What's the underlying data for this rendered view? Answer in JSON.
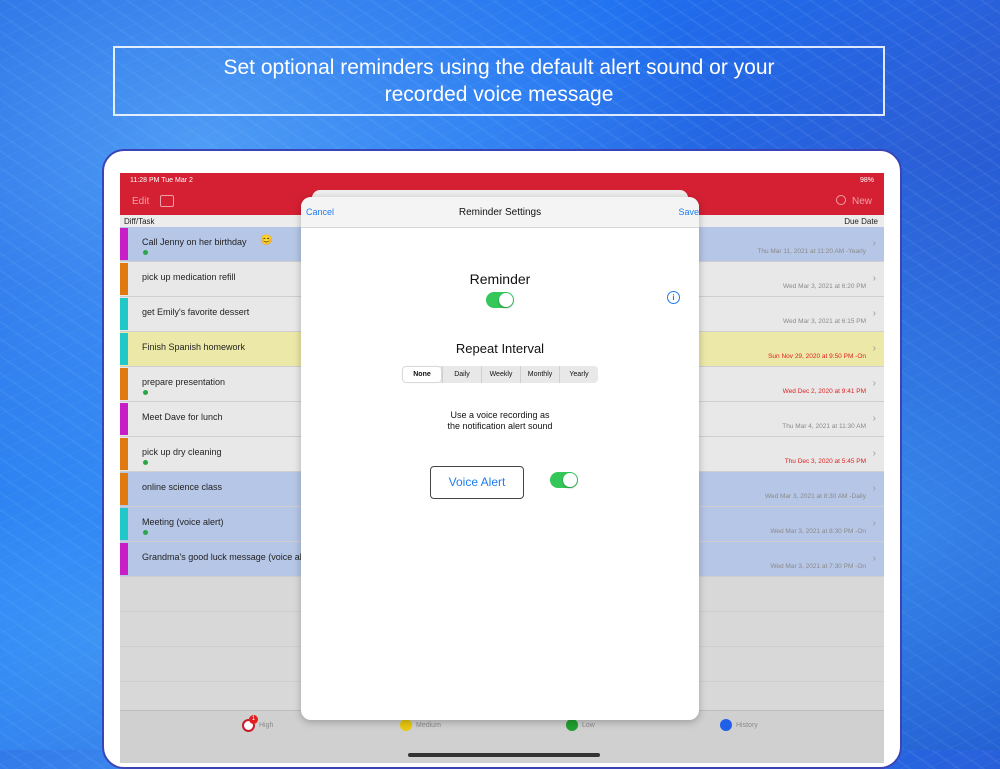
{
  "caption": "Set optional reminders using the default alert sound or your\nrecorded voice message",
  "status": {
    "time": "11:28 PM   Tue Mar 2",
    "battery": "98%"
  },
  "nav": {
    "edit": "Edit",
    "new": "New"
  },
  "columns": {
    "left": "Diff/Task",
    "right": "Due Date"
  },
  "tasks": [
    {
      "title": "Call Jenny on her birthday",
      "emoji": "😊",
      "color": "#c81ec8",
      "bg": "#b6c6e6",
      "dot": true,
      "due": "Thu Mar 11, 2021 at 11:20 AM -Yearly",
      "due_red": false
    },
    {
      "title": "pick up medication refill",
      "emoji": "",
      "color": "#e07a10",
      "bg": "#e8e8e8",
      "dot": false,
      "due": "Wed Mar 3, 2021 at 6:20 PM",
      "due_red": false
    },
    {
      "title": "get Emily's favorite dessert",
      "emoji": "",
      "color": "#20c8c8",
      "bg": "#e8e8e8",
      "dot": false,
      "due": "Wed Mar 3, 2021 at 6:15 PM",
      "due_red": false
    },
    {
      "title": "Finish Spanish homework",
      "emoji": "",
      "color": "#20c8c8",
      "bg": "#ece8a8",
      "dot": false,
      "due": "Sun Nov 29, 2020 at 9:50 PM -On",
      "due_red": true
    },
    {
      "title": "prepare presentation",
      "emoji": "",
      "color": "#e07a10",
      "bg": "#e8e8e8",
      "dot": true,
      "due": "Wed Dec 2, 2020 at 9:41 PM",
      "due_red": true
    },
    {
      "title": "Meet Dave for lunch",
      "emoji": "",
      "color": "#c81ec8",
      "bg": "#e8e8e8",
      "dot": false,
      "due": "Thu Mar 4, 2021 at 11:30 AM",
      "due_red": false
    },
    {
      "title": "pick up dry cleaning",
      "emoji": "",
      "color": "#e07a10",
      "bg": "#e8e8e8",
      "dot": true,
      "due": "Thu Dec 3, 2020 at 5:45 PM",
      "due_red": true
    },
    {
      "title": "online science class",
      "emoji": "",
      "color": "#e07a10",
      "bg": "#b6c6e6",
      "dot": false,
      "due": "Wed Mar 3, 2021 at 8:30 AM -Daily",
      "due_red": false
    },
    {
      "title": "Meeting (voice alert)",
      "emoji": "",
      "color": "#20c8c8",
      "bg": "#b6c6e6",
      "dot": true,
      "due": "Wed Mar 3, 2021 at 8:30 PM -On",
      "due_red": false
    },
    {
      "title": "Grandma's good luck message (voice al",
      "emoji": "",
      "color": "#c81ec8",
      "bg": "#b6c6e6",
      "dot": false,
      "due": "Wed Mar 3, 2021 at 7:30 PM -On",
      "due_red": false
    }
  ],
  "tabs": [
    {
      "label": "High",
      "color": "#c81c28",
      "icon": "high-priority-icon"
    },
    {
      "label": "Medium",
      "color": "#e8c810",
      "icon": "medium-priority-icon"
    },
    {
      "label": "Low",
      "color": "#20a030",
      "icon": "low-priority-icon"
    },
    {
      "label": "History",
      "color": "#2060e8",
      "icon": "history-icon"
    }
  ],
  "modal": {
    "cancel": "Cancel",
    "title": "Reminder Settings",
    "save": "Save",
    "reminder_label": "Reminder",
    "reminder_on": true,
    "repeat_label": "Repeat Interval",
    "intervals": [
      "None",
      "Daily",
      "Weekly",
      "Monthly",
      "Yearly"
    ],
    "selected_interval": "None",
    "voice_text": "Use a voice recording as\nthe notification alert sound",
    "voice_button": "Voice Alert",
    "voice_on": true
  },
  "badge": "1"
}
